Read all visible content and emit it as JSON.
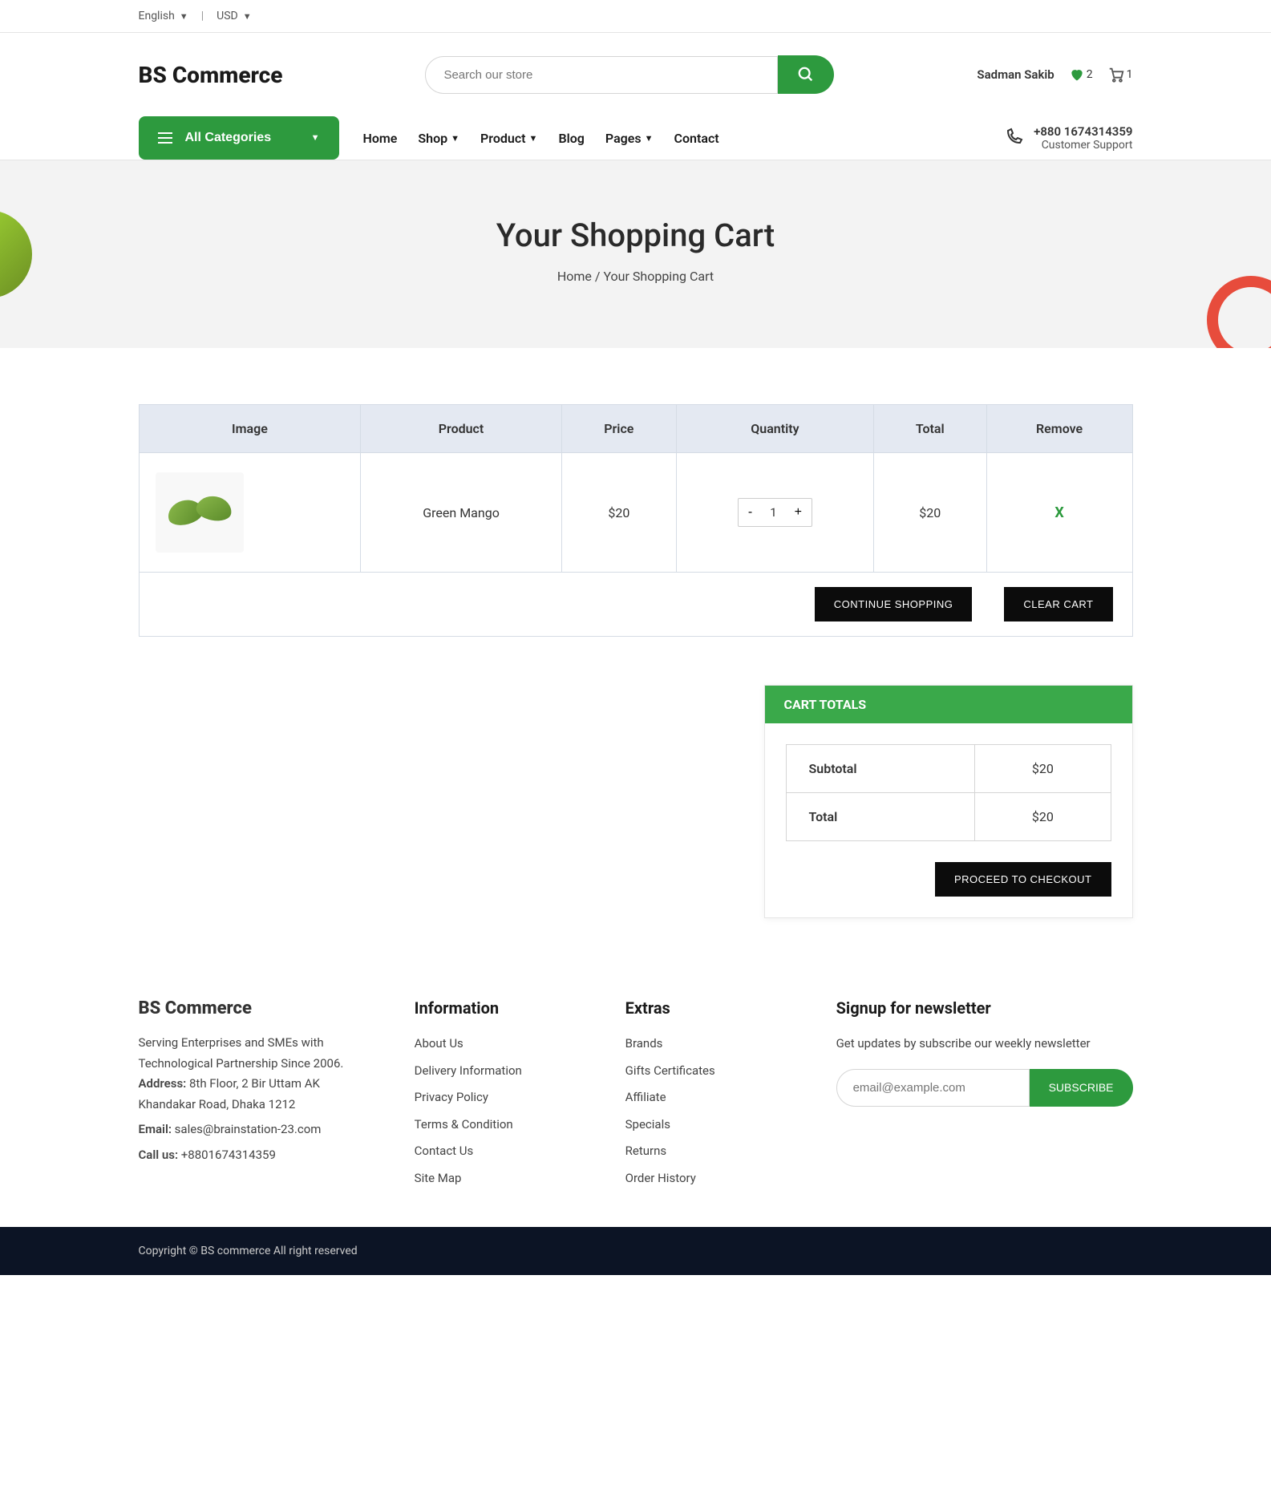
{
  "topbar": {
    "lang": "English",
    "currency": "USD"
  },
  "brand": "BS Commerce",
  "search": {
    "placeholder": "Search our store"
  },
  "user": {
    "name": "Sadman Sakib",
    "wishlist_count": "2",
    "cart_count": "1"
  },
  "categories_label": "All Categories",
  "nav": {
    "home": "Home",
    "shop": "Shop",
    "product": "Product",
    "blog": "Blog",
    "pages": "Pages",
    "contact": "Contact"
  },
  "support": {
    "phone": "+880 1674314359",
    "label": "Customer Support"
  },
  "hero": {
    "title": "Your Shopping Cart",
    "crumb_home": "Home",
    "crumb_sep": "/",
    "crumb_current": "Your Shopping Cart"
  },
  "table": {
    "headers": {
      "image": "Image",
      "product": "Product",
      "price": "Price",
      "qty": "Quantity",
      "total": "Total",
      "remove": "Remove"
    },
    "row": {
      "product": "Green Mango",
      "price": "$20",
      "qty": "1",
      "total": "$20",
      "remove": "X"
    },
    "qty_minus": "-",
    "qty_plus": "+",
    "continue": "CONTINUE SHOPPING",
    "clear": "CLEAR CART"
  },
  "totals": {
    "header": "CART TOTALS",
    "subtotal_label": "Subtotal",
    "subtotal_value": "$20",
    "total_label": "Total",
    "total_value": "$20",
    "checkout": "PROCEED TO CHECKOUT"
  },
  "footer": {
    "brand": "BS Commerce",
    "tagline": "Serving Enterprises and SMEs with Technological Partnership Since 2006.",
    "address_label": "Address:",
    "address": "8th Floor, 2 Bir Uttam AK Khandakar Road, Dhaka 1212",
    "email_label": "Email:",
    "email": "sales@brainstation-23.com",
    "call_label": "Call us:",
    "call": "+8801674314359",
    "info_header": "Information",
    "info": {
      "about": "About Us",
      "delivery": "Delivery Information",
      "privacy": "Privacy Policy",
      "terms": "Terms & Condition",
      "contact": "Contact Us",
      "sitemap": "Site Map"
    },
    "extras_header": "Extras",
    "extras": {
      "brands": "Brands",
      "gifts": "Gifts Certificates",
      "affiliate": "Affiliate",
      "specials": "Specials",
      "returns": "Returns",
      "orders": "Order History"
    },
    "newsletter_header": "Signup for newsletter",
    "newsletter_sub": "Get updates by subscribe our weekly newsletter",
    "newsletter_placeholder": "email@example.com",
    "subscribe": "SUBSCRIBE"
  },
  "copyright": "Copyright © BS commerce All right reserved"
}
